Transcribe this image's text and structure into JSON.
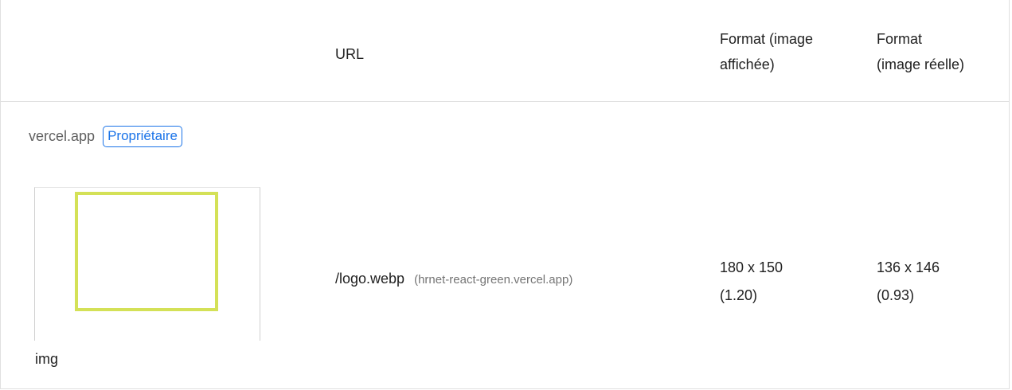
{
  "header": {
    "url_label": "URL",
    "displayed_label_line1": "Format (image",
    "displayed_label_line2": "affichée)",
    "actual_label_line1": "Format",
    "actual_label_line2": "(image réelle)"
  },
  "entity": {
    "name": "vercel.app",
    "badge": "Propriétaire"
  },
  "row": {
    "node_label": "img",
    "url_path": "/logo.webp",
    "url_host": "(hrnet-react-green.vercel.app)",
    "displayed_size": "180 x 150",
    "displayed_ratio": "(1.20)",
    "actual_size": "136 x 146",
    "actual_ratio": "(0.93)"
  },
  "colors": {
    "badge": "#1a73e8",
    "thumbnail_outline": "#d4e157"
  }
}
